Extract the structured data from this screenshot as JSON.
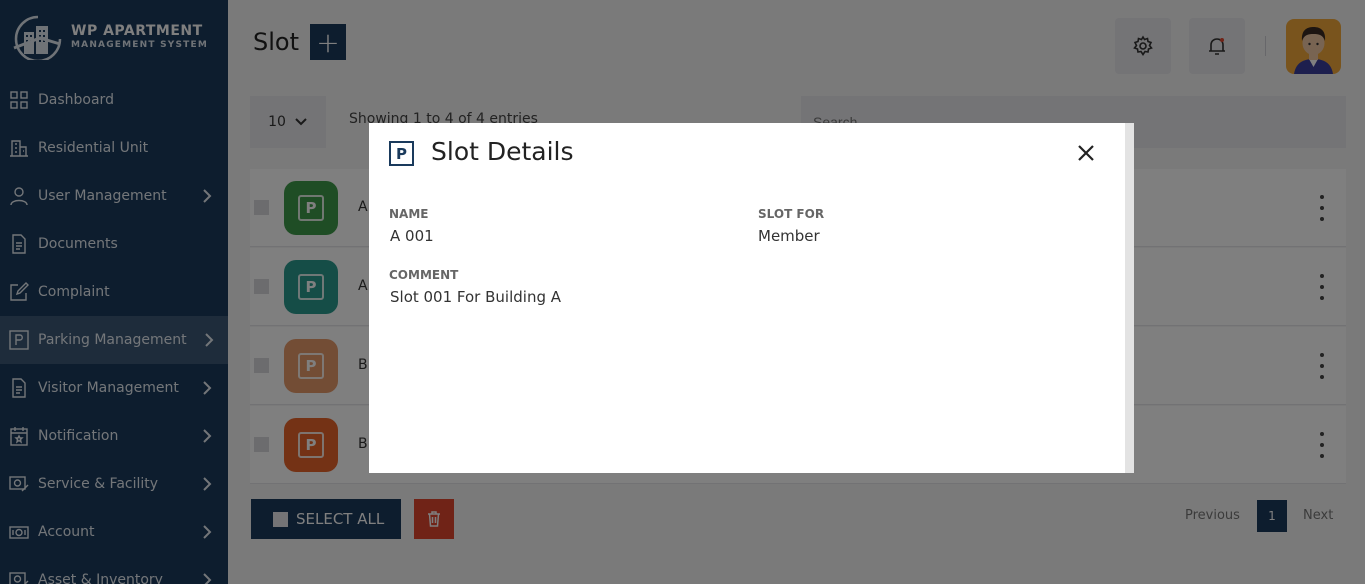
{
  "app": {
    "logo_title": "WP APARTMENT",
    "logo_subtitle": "MANAGEMENT SYSTEM"
  },
  "sidebar": {
    "items": [
      {
        "label": "Dashboard",
        "icon": "grid-icon",
        "has_submenu": false,
        "active": false
      },
      {
        "label": "Residential Unit",
        "icon": "building-icon",
        "has_submenu": false,
        "active": false
      },
      {
        "label": "User Management",
        "icon": "user-icon",
        "has_submenu": true,
        "active": false
      },
      {
        "label": "Documents",
        "icon": "document-icon",
        "has_submenu": false,
        "active": false
      },
      {
        "label": "Complaint",
        "icon": "edit-icon",
        "has_submenu": false,
        "active": false
      },
      {
        "label": "Parking Management",
        "icon": "parking-icon",
        "has_submenu": true,
        "active": true
      },
      {
        "label": "Visitor Management",
        "icon": "document-icon",
        "has_submenu": true,
        "active": false
      },
      {
        "label": "Notification",
        "icon": "calendar-icon",
        "has_submenu": true,
        "active": false
      },
      {
        "label": "Service & Facility",
        "icon": "service-icon",
        "has_submenu": true,
        "active": false
      },
      {
        "label": "Account",
        "icon": "money-icon",
        "has_submenu": true,
        "active": false
      },
      {
        "label": "Asset & Inventory",
        "icon": "asset-icon",
        "has_submenu": true,
        "active": false
      }
    ]
  },
  "header": {
    "title": "Slot",
    "add_label": "+"
  },
  "table": {
    "page_length": "10",
    "info": "Showing 1 to 4 of 4 entries",
    "search_placeholder": "Search...",
    "rows": [
      {
        "name": "A",
        "color": "#3f9a4a"
      },
      {
        "name": "A",
        "color": "#2b9b8f"
      },
      {
        "name": "B",
        "color": "#e69a6a"
      },
      {
        "name": "B",
        "color": "#e8652a"
      }
    ]
  },
  "footer": {
    "select_all_label": "SELECT ALL",
    "prev_label": "Previous",
    "page": "1",
    "next_label": "Next"
  },
  "modal": {
    "icon_letter": "P",
    "title": "Slot Details",
    "name_label": "NAME",
    "name_value": "A 001",
    "slot_for_label": "SLOT FOR",
    "slot_for_value": "Member",
    "comment_label": "COMMENT",
    "comment_value": "Slot 001 For Building A"
  },
  "colors": {
    "sidebar": "#1a3a5c",
    "active_item": "#3d5877",
    "delete": "#e0472f",
    "avatar_bg": "#f2a93b"
  }
}
